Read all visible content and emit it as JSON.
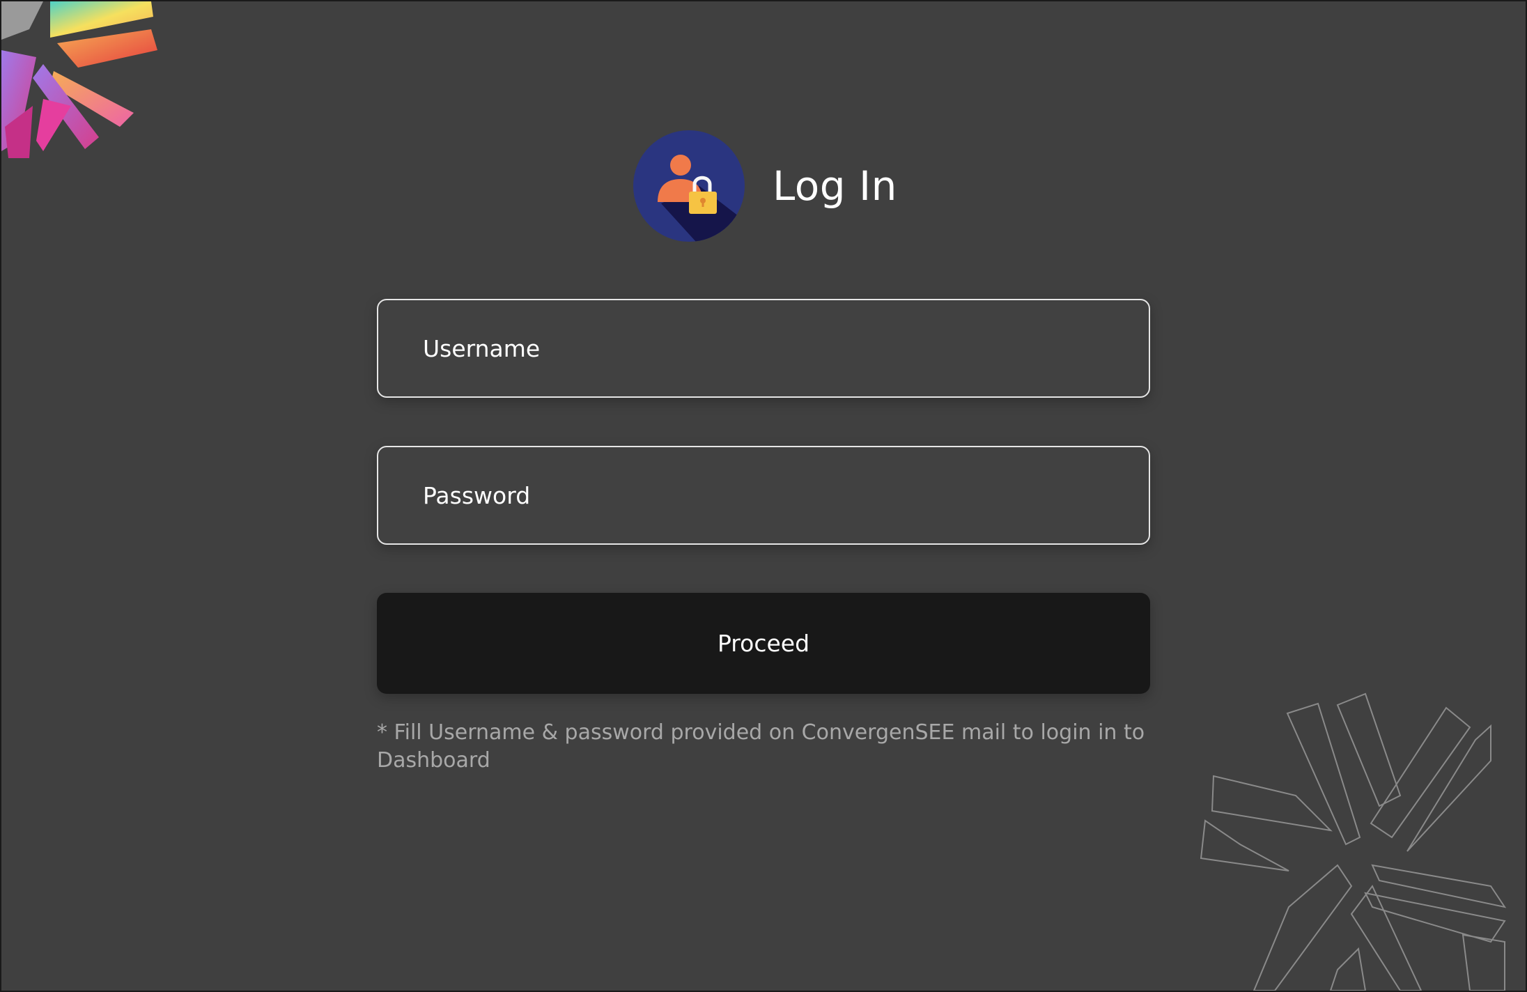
{
  "header": {
    "title": "Log In",
    "icon": "user-lock-icon"
  },
  "form": {
    "username_placeholder": "Username",
    "password_placeholder": "Password",
    "proceed_label": "Proceed",
    "note": "* Fill Username & password provided on ConvergenSEE mail to login in to Dashboard"
  },
  "colors": {
    "background": "#404040",
    "button": "#181818",
    "avatar_circle": "#2a3580",
    "person": "#f07a4a",
    "lock": "#f6c343"
  }
}
